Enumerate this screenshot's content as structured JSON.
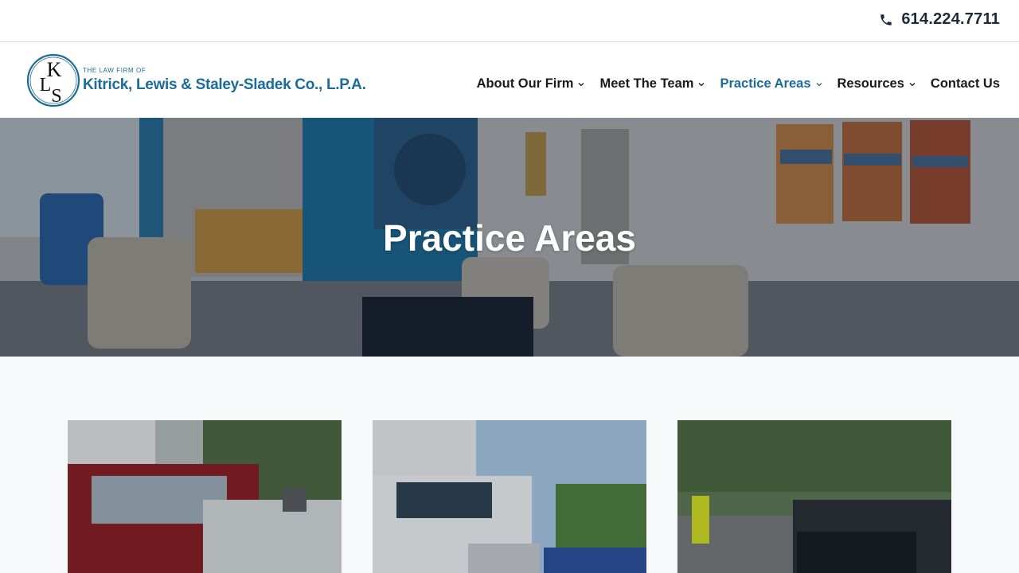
{
  "topbar": {
    "phone": "614.224.7711",
    "phone_icon": "phone-icon"
  },
  "logo": {
    "tagline": "THE LAW FIRM OF",
    "name": "Kitrick, Lewis & Staley-Sladek Co., L.P.A.",
    "monogram": "KLS"
  },
  "nav": {
    "items": [
      {
        "label": "About Our Firm",
        "has_dropdown": true,
        "active": false
      },
      {
        "label": "Meet The Team",
        "has_dropdown": true,
        "active": false
      },
      {
        "label": "Practice Areas",
        "has_dropdown": true,
        "active": true
      },
      {
        "label": "Resources",
        "has_dropdown": true,
        "active": false
      },
      {
        "label": "Contact Us",
        "has_dropdown": false,
        "active": false
      }
    ]
  },
  "hero": {
    "title": "Practice Areas"
  },
  "cards": [
    {
      "image": "car-accident-photo"
    },
    {
      "image": "truck-accident-photo"
    },
    {
      "image": "motorcycle-accident-photo"
    }
  ],
  "colors": {
    "brand_blue": "#1c6b9a",
    "text_dark": "#1a1a1a",
    "page_bg": "#f6f8fa"
  }
}
